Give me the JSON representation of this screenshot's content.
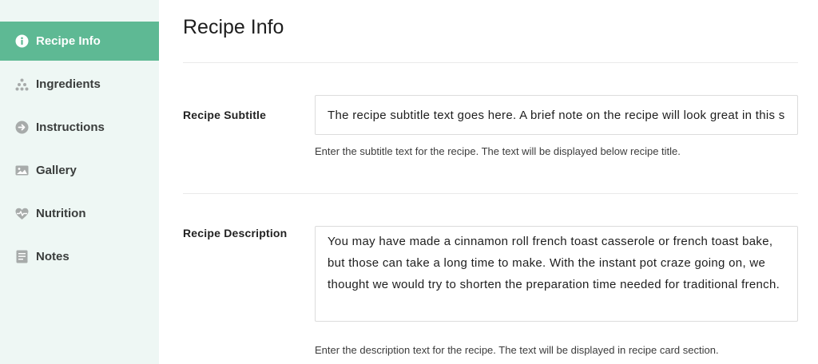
{
  "sidebar": {
    "items": [
      {
        "label": "Recipe Info",
        "icon": "info-icon",
        "active": true
      },
      {
        "label": "Ingredients",
        "icon": "ingredients-icon",
        "active": false
      },
      {
        "label": "Instructions",
        "icon": "arrow-right-circle-icon",
        "active": false
      },
      {
        "label": "Gallery",
        "icon": "gallery-icon",
        "active": false
      },
      {
        "label": "Nutrition",
        "icon": "heart-pulse-icon",
        "active": false
      },
      {
        "label": "Notes",
        "icon": "notes-icon",
        "active": false
      }
    ]
  },
  "main": {
    "title": "Recipe Info",
    "subtitle_field": {
      "label": "Recipe Subtitle",
      "value": "The recipe subtitle text goes here. A brief note on the recipe will look great in this section.",
      "help": "Enter the subtitle text for the recipe. The text will be displayed below recipe title."
    },
    "description_field": {
      "label": "Recipe Description",
      "value": "You may have made a cinnamon roll french toast casserole or french toast bake, but those can take a long time to make. With the instant pot craze going on, we thought we would try to shorten the preparation time needed for traditional french.",
      "help": "Enter the description text for the recipe. The text will be displayed in recipe card section."
    }
  },
  "colors": {
    "accent": "#5eb994",
    "sidebar_bg": "#eef7f4",
    "icon_gray": "#a7abaa"
  }
}
